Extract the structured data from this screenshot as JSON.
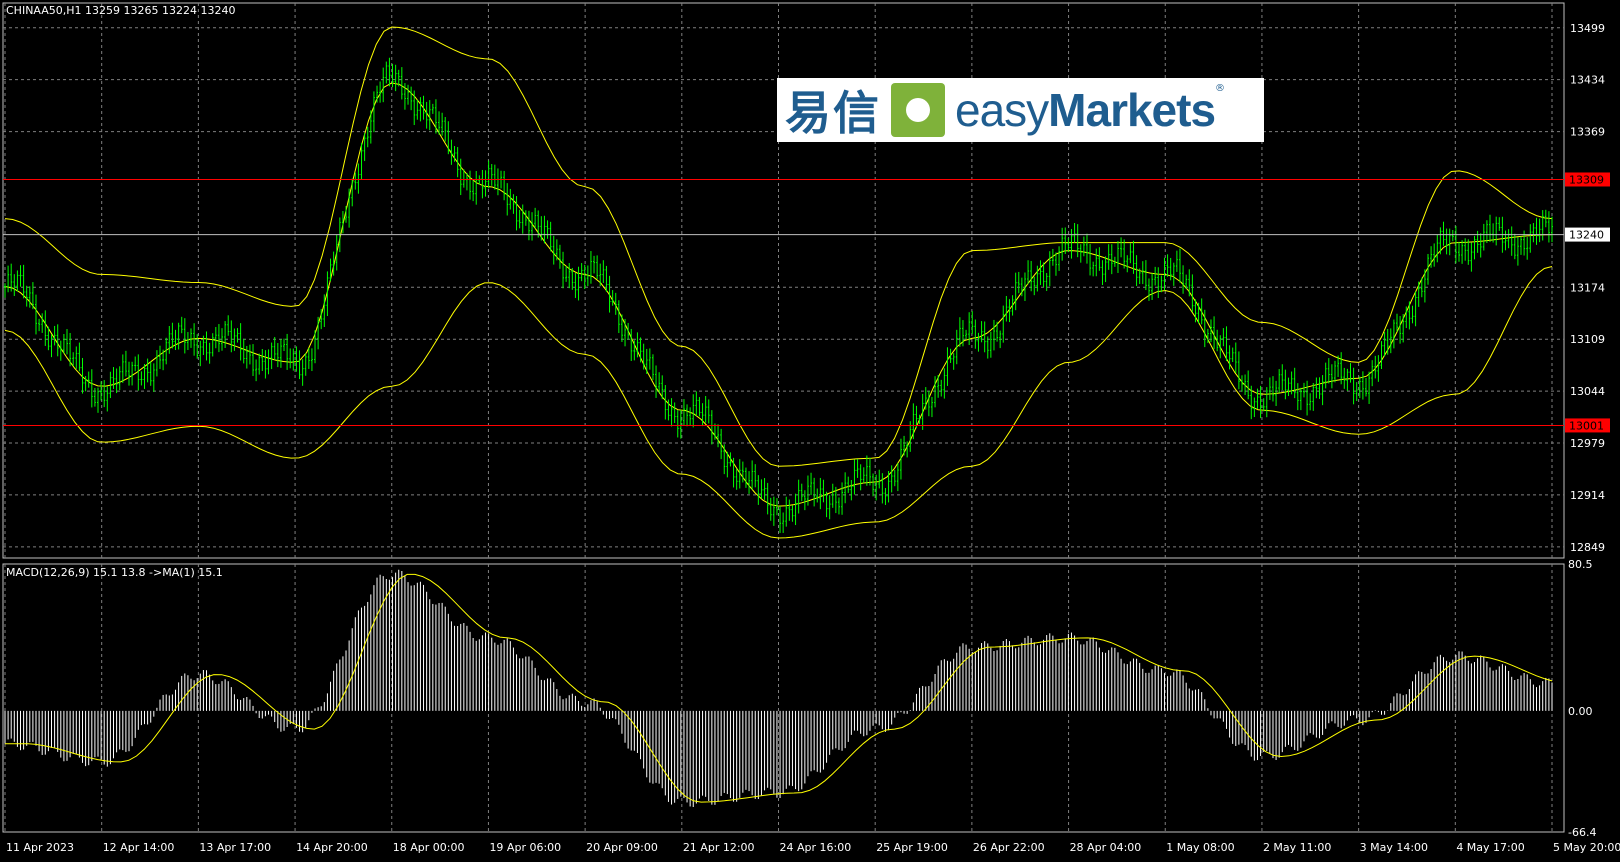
{
  "symbol_header": "CHINAA50,H1  13259 13265 13224 13240",
  "macd_header": "MACD(12,26,9) 15.1 13.8  ->MA(1) 15.1",
  "logo": {
    "cn_text": "易信",
    "en_light": "easy",
    "en_bold": "Markets",
    "reg": "®"
  },
  "colors": {
    "background": "#000000",
    "grid": "#7f7f7f",
    "candles": "#00ff00",
    "bands": "#ffff00",
    "hline": "#ff0000",
    "macd_hist": "#ffffff",
    "macd_signal": "#ffff00",
    "current_price_line": "#c0c0c0"
  },
  "price_axis": [
    "13499",
    "13434",
    "13369",
    "13174",
    "13109",
    "13044",
    "12979",
    "12914",
    "12849"
  ],
  "price_tags": {
    "upper_level": "13309",
    "current": "13240",
    "lower_level": "13001"
  },
  "macd_axis": [
    "80.5",
    "0.00",
    "-66.4"
  ],
  "time_axis": [
    "11 Apr 2023",
    "12 Apr 14:00",
    "13 Apr 17:00",
    "14 Apr 20:00",
    "18 Apr 00:00",
    "19 Apr 06:00",
    "20 Apr 09:00",
    "21 Apr 12:00",
    "24 Apr 16:00",
    "25 Apr 19:00",
    "26 Apr 22:00",
    "28 Apr 04:00",
    "1 May 08:00",
    "2 May 11:00",
    "3 May 14:00",
    "4 May 17:00",
    "5 May 20:00"
  ],
  "chart_data": {
    "type": "line",
    "title": "CHINAA50,H1",
    "ohlc_last": {
      "open": 13259,
      "high": 13265,
      "low": 13224,
      "close": 13240
    },
    "horizontal_levels": [
      13309,
      13001
    ],
    "current_price": 13240,
    "x": [
      "11 Apr 2023",
      "12 Apr 14:00",
      "13 Apr 17:00",
      "14 Apr 20:00",
      "18 Apr 00:00",
      "19 Apr 06:00",
      "20 Apr 09:00",
      "21 Apr 12:00",
      "24 Apr 16:00",
      "25 Apr 19:00",
      "26 Apr 22:00",
      "28 Apr 04:00",
      "1 May 08:00",
      "2 May 11:00",
      "3 May 14:00",
      "4 May 17:00",
      "5 May 20:00"
    ],
    "ylim": [
      12835,
      13530
    ],
    "series": [
      {
        "values": [
          13175,
          13050,
          13110,
          13080,
          13430,
          13300,
          13190,
          13020,
          12900,
          12930,
          13110,
          13220,
          13190,
          13040,
          13060,
          13230,
          13240
        ]
      },
      {
        "values": [
          13260,
          13190,
          13180,
          13150,
          13500,
          13460,
          13300,
          13100,
          12950,
          12960,
          13220,
          13230,
          13230,
          13130,
          13080,
          13320,
          13260
        ]
      },
      {
        "values": [
          13120,
          12980,
          13000,
          12960,
          13050,
          13180,
          13090,
          12940,
          12860,
          12880,
          12950,
          13080,
          13170,
          13020,
          12990,
          13040,
          13200
        ]
      }
    ],
    "macd": {
      "ylim": [
        -66.4,
        80.5
      ],
      "values": [
        -18,
        -28,
        20,
        -10,
        75,
        40,
        5,
        -50,
        -45,
        -10,
        35,
        40,
        22,
        -25,
        -5,
        30,
        15.1
      ],
      "signal": 13.8,
      "ma": 15.1
    }
  }
}
